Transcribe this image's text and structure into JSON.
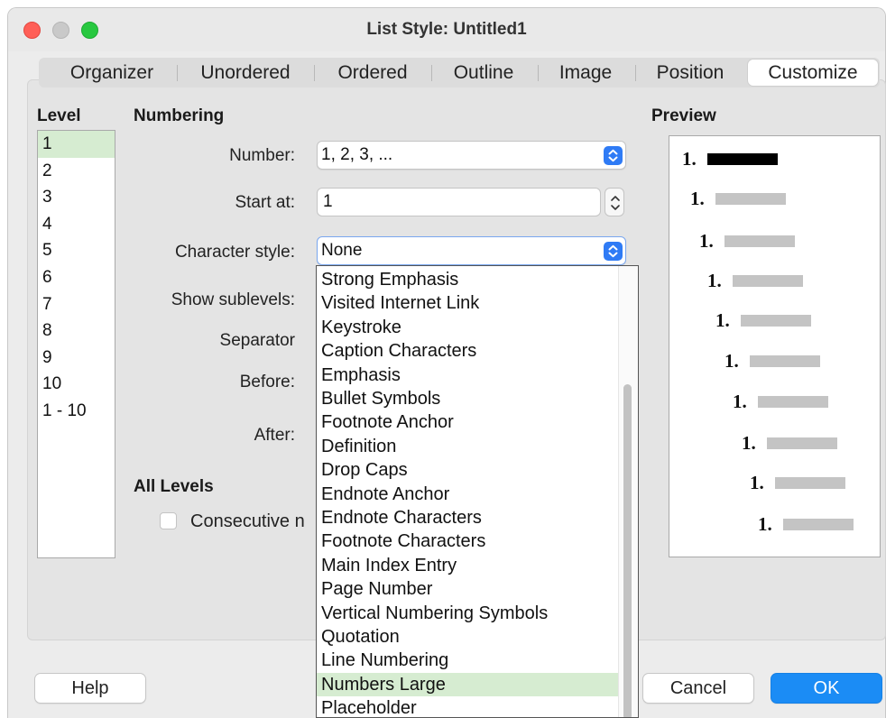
{
  "window": {
    "title": "List Style: Untitled1"
  },
  "tabs": [
    "Organizer",
    "Unordered",
    "Ordered",
    "Outline",
    "Image",
    "Position",
    "Customize"
  ],
  "active_tab": "Customize",
  "level": {
    "heading": "Level",
    "items": [
      "1",
      "2",
      "3",
      "4",
      "5",
      "6",
      "7",
      "8",
      "9",
      "10",
      "1 - 10"
    ],
    "selected": "1"
  },
  "numbering": {
    "heading": "Numbering",
    "number_label": "Number:",
    "number_value": "1, 2, 3, ...",
    "start_label": "Start at:",
    "start_value": "1",
    "charstyle_label": "Character style:",
    "charstyle_value": "None",
    "sublevels_label": "Show sublevels:",
    "separator_label": "Separator",
    "before_label": "Before:",
    "after_label": "After:"
  },
  "all_levels": {
    "heading": "All Levels",
    "consecutive_label": "Consecutive n",
    "consecutive_checked": false
  },
  "preview": {
    "heading": "Preview",
    "rows": [
      "1.",
      "1.",
      "1.",
      "1.",
      "1.",
      "1.",
      "1.",
      "1.",
      "1.",
      "1."
    ]
  },
  "character_style_dropdown": {
    "items": [
      "Strong Emphasis",
      "Visited Internet Link",
      "Keystroke",
      "Caption Characters",
      "Emphasis",
      "Bullet Symbols",
      "Footnote Anchor",
      "Definition",
      "Drop Caps",
      "Endnote Anchor",
      "Endnote Characters",
      "Footnote Characters",
      "Main Index Entry",
      "Page Number",
      "Vertical Numbering Symbols",
      "Quotation",
      "Line Numbering",
      "Numbers Large",
      "Placeholder"
    ],
    "highlighted": "Numbers Large"
  },
  "buttons": {
    "help": "Help",
    "cancel": "Cancel",
    "ok": "OK"
  },
  "colors": {
    "accent": "#1b8cf5",
    "selection": "#d6ecd1",
    "close": "#ff5f57",
    "maximize": "#28c840"
  }
}
